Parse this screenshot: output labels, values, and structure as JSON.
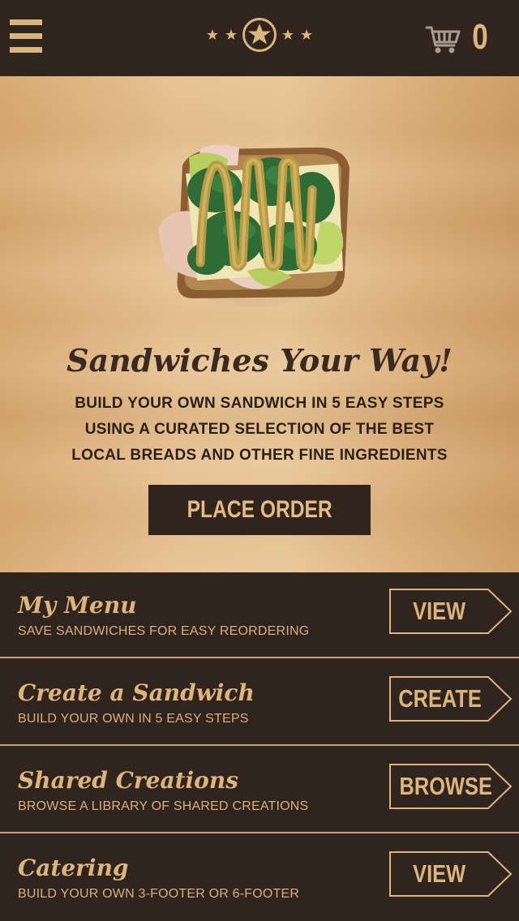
{
  "header": {
    "cart_count": "0",
    "icons": {
      "menu": "hamburger-menu-icon",
      "logo": "star-logo",
      "cart": "shopping-cart-icon"
    }
  },
  "hero": {
    "image": "open-faced-sandwich-image",
    "title": "Sandwiches Your Way!",
    "lines": [
      "BUILD YOUR OWN SANDWICH IN 5 EASY STEPS",
      "USING A CURATED SELECTION OF THE BEST",
      "LOCAL BREADS AND OTHER FINE INGREDIENTS"
    ],
    "cta_label": "PLACE ORDER"
  },
  "menu": [
    {
      "title": "My Menu",
      "subtitle": "SAVE SANDWICHES FOR EASY REORDERING",
      "button": "VIEW"
    },
    {
      "title": "Create a Sandwich",
      "subtitle": "BUILD YOUR OWN IN 5 EASY STEPS",
      "button": "CREATE"
    },
    {
      "title": "Shared Creations",
      "subtitle": "BROWSE A LIBRARY OF SHARED CREATIONS",
      "button": "BROWSE"
    },
    {
      "title": "Catering",
      "subtitle": "BUILD YOUR OWN 3-FOOTER OR 6-FOOTER",
      "button": "VIEW"
    }
  ],
  "colors": {
    "dark_brown": "#2f241e",
    "tan_accent": "#dcb57d",
    "wood": "#e6c293",
    "text_dark": "#2c1f18"
  }
}
